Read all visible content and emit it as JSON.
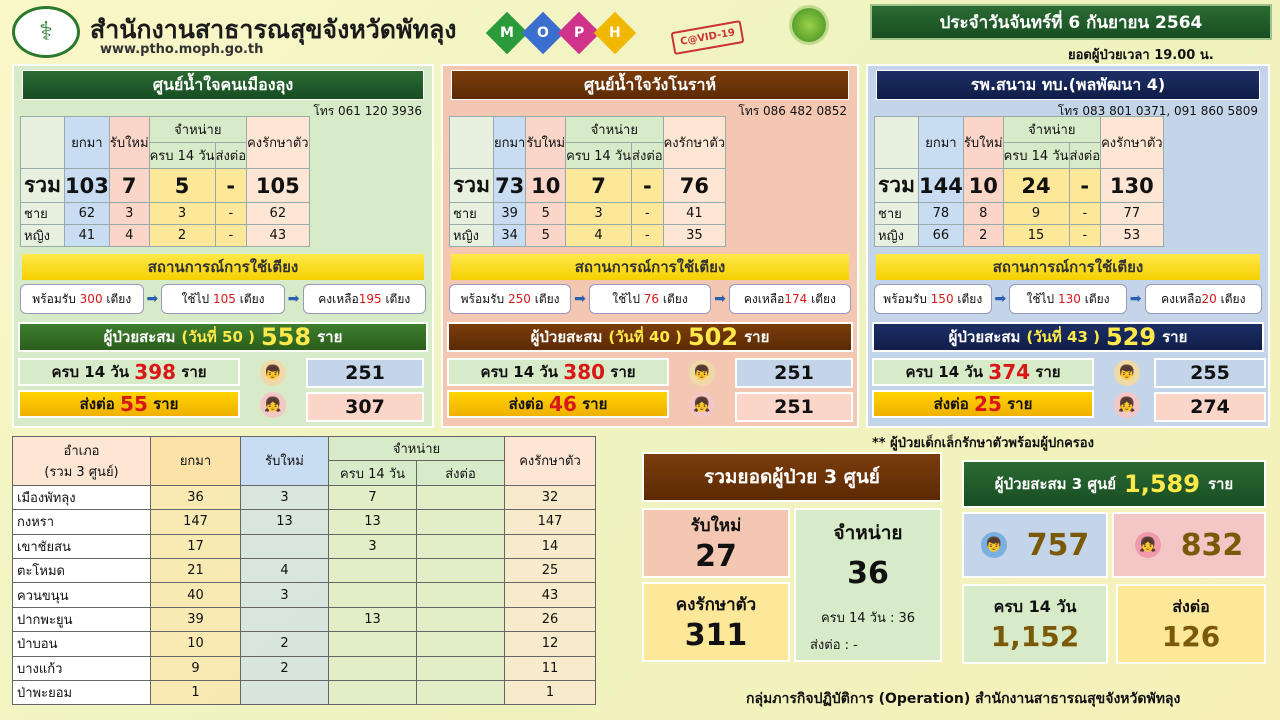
{
  "header": {
    "org": "สำนักงานสาธารณสุขจังหวัดพัทลุง",
    "url": "www.ptho.moph.go.th",
    "moph": [
      "M",
      "O",
      "P",
      "H"
    ],
    "covid": "C@VID-19",
    "date": "ประจำวันจันทร์ที่ 6 กันยายน 2564",
    "time": "ยอดผู้ป่วยเวลา 19.00 น."
  },
  "labels": {
    "carried": "ยกมา",
    "new": "รับใหม่",
    "discharge": "จำหน่าย",
    "complete14": "ครบ 14 วัน",
    "refer": "ส่งต่อ",
    "remaining": "คงรักษาตัว",
    "total": "รวม",
    "male": "ชาย",
    "female": "หญิง",
    "beds": "สถานการณ์การใช้เตียง",
    "cum_prefix": "ผู้ป่วยสะสม",
    "unit": "ราย"
  },
  "centers": [
    {
      "name": "ศูนย์น้ำใจคนเมืองลุง",
      "phone": "โทร 061 120 3936",
      "total": [
        "103",
        "7",
        "5",
        "-",
        "105"
      ],
      "male": [
        "62",
        "3",
        "3",
        "-",
        "62"
      ],
      "female": [
        "41",
        "4",
        "2",
        "-",
        "43"
      ],
      "bed_ready": "พร้อมรับ",
      "bed_ready_n": "300",
      "bed_used": "ใช้ไป",
      "bed_used_n": "105",
      "bed_left": "คงเหลือ",
      "bed_left_n": "195",
      "bed_unit": "เตียง",
      "day": "(วันที่ 50 )",
      "cum": "558",
      "comp_label": "ครบ 14 วัน",
      "comp": "398",
      "refer_label": "ส่งต่อ",
      "refer": "55",
      "boys": "251",
      "girls": "307"
    },
    {
      "name": "ศูนย์น้ำใจวังโนราห์",
      "phone": "โทร 086 482 0852",
      "total": [
        "73",
        "10",
        "7",
        "-",
        "76"
      ],
      "male": [
        "39",
        "5",
        "3",
        "-",
        "41"
      ],
      "female": [
        "34",
        "5",
        "4",
        "-",
        "35"
      ],
      "bed_ready": "พร้อมรับ",
      "bed_ready_n": "250",
      "bed_used": "ใช้ไป",
      "bed_used_n": "76",
      "bed_left": "คงเหลือ",
      "bed_left_n": "174",
      "bed_unit": "เตียง",
      "day": "(วันที่ 40 )",
      "cum": "502",
      "comp_label": "ครบ 14 วัน",
      "comp": "380",
      "refer_label": "ส่งต่อ",
      "refer": "46",
      "boys": "251",
      "girls": "251"
    },
    {
      "name": "รพ.สนาม ทบ.(พลพัฒนา 4)",
      "phone": "โทร 083 801 0371, 091 860 5809",
      "total": [
        "144",
        "10",
        "24",
        "-",
        "130"
      ],
      "male": [
        "78",
        "8",
        "9",
        "-",
        "77"
      ],
      "female": [
        "66",
        "2",
        "15",
        "-",
        "53"
      ],
      "bed_ready": "พร้อมรับ",
      "bed_ready_n": "150",
      "bed_used": "ใช้ไป",
      "bed_used_n": "130",
      "bed_left": "คงเหลือ",
      "bed_left_n": "20",
      "bed_unit": "เตียง",
      "day": "(วันที่ 43 )",
      "cum": "529",
      "comp_label": "ครบ 14 วัน",
      "comp": "374",
      "refer_label": "ส่งต่อ",
      "refer": "25",
      "boys": "255",
      "girls": "274"
    }
  ],
  "district": {
    "head1": "อำเภอ",
    "head2": "(รวม 3 ศูนย์)",
    "rows": [
      [
        "เมืองพัทลุง",
        "36",
        "3",
        "7",
        "",
        "32"
      ],
      [
        "กงหรา",
        "147",
        "13",
        "13",
        "",
        "147"
      ],
      [
        "เขาชัยสน",
        "17",
        "",
        "3",
        "",
        "14"
      ],
      [
        "ตะโหมด",
        "21",
        "4",
        "",
        "",
        "25"
      ],
      [
        "ควนขนุน",
        "40",
        "3",
        "",
        "",
        "43"
      ],
      [
        "ปากพะยูน",
        "39",
        "",
        "13",
        "",
        "26"
      ],
      [
        "ป่าบอน",
        "10",
        "2",
        "",
        "",
        "12"
      ],
      [
        "บางแก้ว",
        "9",
        "2",
        "",
        "",
        "11"
      ],
      [
        "ป่าพะยอม",
        "1",
        "",
        "",
        "",
        "1"
      ]
    ]
  },
  "note": "** ผู้ป่วยเด็กเล็กรักษาตัวพร้อมผู้ปกครอง",
  "summary": {
    "title": "รวมยอดผู้ป่วย 3 ศูนย์",
    "new_label": "รับใหม่",
    "new": "27",
    "dis_label": "จำหน่าย",
    "dis": "36",
    "dis_comp": "ครบ 14 วัน  : 36",
    "dis_refer": "ส่งต่อ : -",
    "rem_label": "คงรักษาตัว",
    "rem": "311"
  },
  "cumulative": {
    "label": "ผู้ป่วยสะสม 3 ศูนย์",
    "value": "1,589",
    "unit": "ราย",
    "boys": "757",
    "girls": "832",
    "comp_label": "ครบ 14 วัน",
    "comp": "1,152",
    "refer_label": "ส่งต่อ",
    "refer": "126"
  },
  "footer": "กลุ่มภารกิจปฏิบัติการ (Operation) สำนักงานสาธารณสุขจังหวัดพัทลุง",
  "colors": {
    "green": "#2b6b33",
    "brown": "#7b3d0c",
    "navy": "#1c2f66",
    "yellow": "#ffe84a"
  }
}
